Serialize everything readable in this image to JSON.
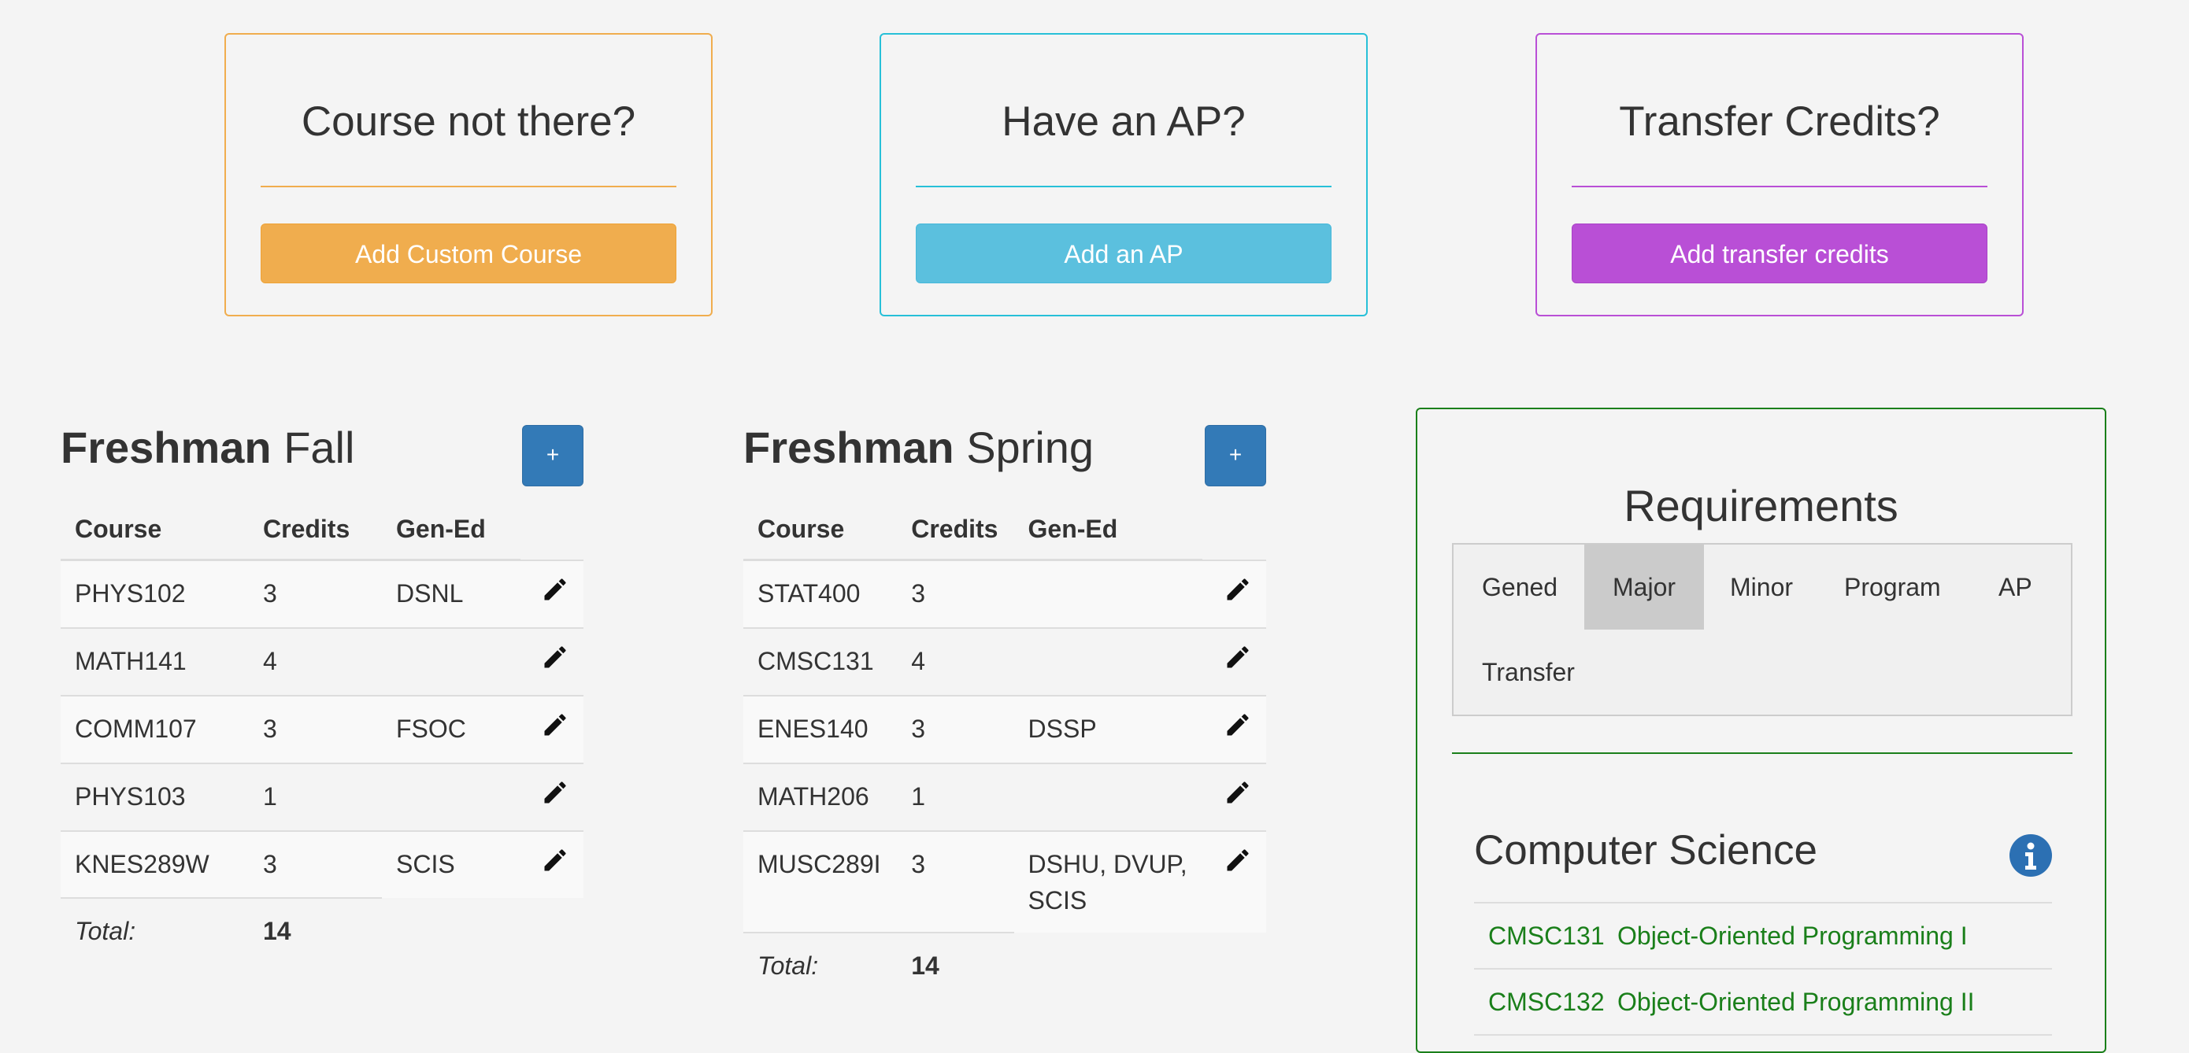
{
  "cards": [
    {
      "title": "Course not there?",
      "button": "Add Custom Course",
      "color": "#f0ad4e",
      "border": "#f0ad4e"
    },
    {
      "title": "Have an AP?",
      "button": "Add an AP",
      "color": "#5bc0de",
      "border": "#27c0d8"
    },
    {
      "title": "Transfer Credits?",
      "button": "Add transfer credits",
      "color": "#b94fd6",
      "border": "#b94fd6"
    }
  ],
  "semesters": [
    {
      "year": "Freshman",
      "term": "Fall",
      "add_label": "+",
      "headers": [
        "Course",
        "Credits",
        "Gen-Ed"
      ],
      "rows": [
        {
          "course": "PHYS102",
          "credits": "3",
          "gened": "DSNL"
        },
        {
          "course": "MATH141",
          "credits": "4",
          "gened": ""
        },
        {
          "course": "COMM107",
          "credits": "3",
          "gened": "FSOC"
        },
        {
          "course": "PHYS103",
          "credits": "1",
          "gened": ""
        },
        {
          "course": "KNES289W",
          "credits": "3",
          "gened": "SCIS"
        }
      ],
      "total_label": "Total:",
      "total": "14"
    },
    {
      "year": "Freshman",
      "term": "Spring",
      "add_label": "+",
      "headers": [
        "Course",
        "Credits",
        "Gen-Ed"
      ],
      "rows": [
        {
          "course": "STAT400",
          "credits": "3",
          "gened": ""
        },
        {
          "course": "CMSC131",
          "credits": "4",
          "gened": ""
        },
        {
          "course": "ENES140",
          "credits": "3",
          "gened": "DSSP"
        },
        {
          "course": "MATH206",
          "credits": "1",
          "gened": ""
        },
        {
          "course": "MUSC289I",
          "credits": "3",
          "gened": "DSHU, DVUP, SCIS"
        }
      ],
      "total_label": "Total:",
      "total": "14"
    }
  ],
  "requirements": {
    "title": "Requirements",
    "tabs": [
      "Gened",
      "Major",
      "Minor",
      "Program",
      "AP",
      "Transfer"
    ],
    "active_tab": "Major",
    "major_name": "Computer Science",
    "info_icon": "info-icon",
    "items": [
      {
        "code": "CMSC131",
        "name": "Object-Oriented Programming I"
      },
      {
        "code": "CMSC132",
        "name": "Object-Oriented Programming II"
      }
    ],
    "accent": "#1a7f1a"
  }
}
